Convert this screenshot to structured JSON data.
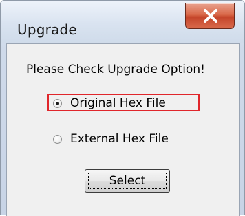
{
  "window": {
    "title": "Upgrade",
    "close_icon": "close-x-icon"
  },
  "dialog": {
    "prompt": "Please Check Upgrade Option!",
    "options": [
      {
        "label": "Original Hex File",
        "selected": true
      },
      {
        "label": "External Hex File",
        "selected": false
      }
    ],
    "select_label": "Select"
  },
  "colors": {
    "highlight_border": "#e0262b",
    "close_button": "#c4452a"
  }
}
